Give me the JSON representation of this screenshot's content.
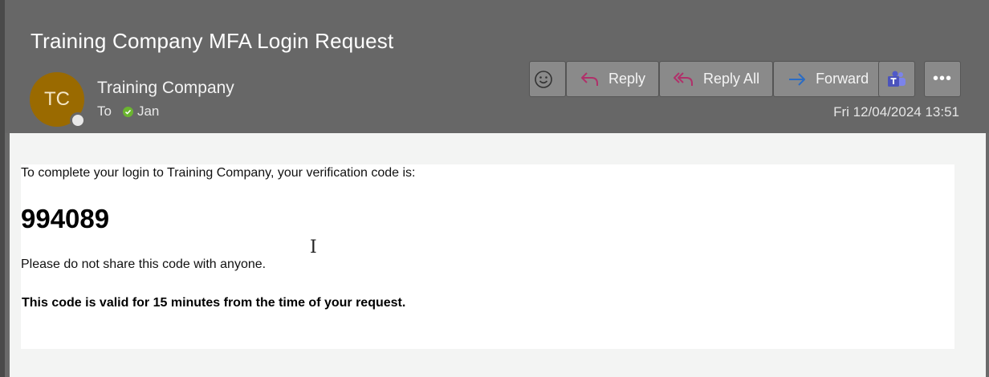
{
  "email": {
    "subject": "Training Company MFA Login Request",
    "sender_initials": "TC",
    "sender_name": "Training Company",
    "to_label": "To",
    "recipient": "Jan",
    "date": "Fri 12/04/2024 13:51"
  },
  "toolbar": {
    "emoji_icon": "smiley-icon",
    "reply_label": "Reply",
    "reply_all_label": "Reply All",
    "forward_label": "Forward",
    "teams_icon": "teams-icon",
    "more_label": "•••"
  },
  "message": {
    "intro": "To complete your login to Training Company, your verification code is:",
    "code": "994089",
    "warning": "Please do not share this code with anyone.",
    "validity": "This code is valid for 15 minutes from the time of your request."
  },
  "colors": {
    "header_bg": "#676767",
    "avatar_bg": "#9a6a00",
    "reply_icon": "#b0306a",
    "forward_icon": "#2b6cc4",
    "presence_green": "#6bb52f"
  }
}
